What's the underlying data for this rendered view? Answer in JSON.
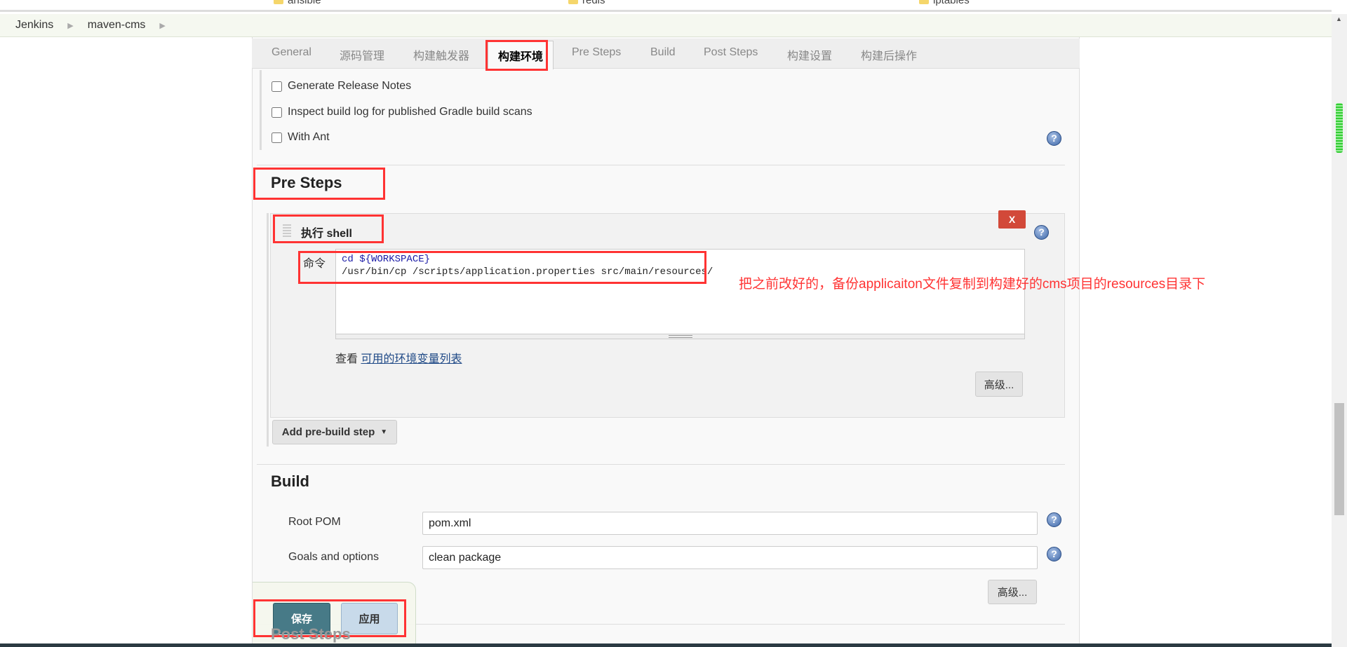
{
  "bookmarks": [
    {
      "label": "ansible",
      "icon": "folder-icon"
    },
    {
      "label": "redis",
      "icon": "folder-icon"
    },
    {
      "label": "iptables",
      "icon": "folder-icon"
    }
  ],
  "breadcrumb": [
    "Jenkins",
    "maven-cms"
  ],
  "tabs": [
    {
      "label": "General"
    },
    {
      "label": "源码管理"
    },
    {
      "label": "构建触发器"
    },
    {
      "label": "构建环境",
      "active": true
    },
    {
      "label": "Pre Steps"
    },
    {
      "label": "Build"
    },
    {
      "label": "Post Steps"
    },
    {
      "label": "构建设置"
    },
    {
      "label": "构建后操作"
    }
  ],
  "build_env": {
    "options": [
      {
        "label": "Generate Release Notes",
        "checked": false
      },
      {
        "label": "Inspect build log for published Gradle build scans",
        "checked": false
      },
      {
        "label": "With Ant",
        "checked": false
      }
    ]
  },
  "pre_steps": {
    "title": "Pre Steps",
    "shell": {
      "title": "执行 shell",
      "delete_label": "X",
      "command_label": "命令",
      "command_lines": [
        "cd ${WORKSPACE}",
        "/usr/bin/cp /scripts/application.properties src/main/resources/"
      ],
      "view_prefix": "查看",
      "env_link": "可用的环境变量列表",
      "advanced_label": "高级..."
    },
    "add_step_label": "Add pre-build step"
  },
  "annotation": "把之前改好的，备份applicaiton文件复制到构建好的cms项目的resources目录下",
  "build": {
    "title": "Build",
    "root_pom_label": "Root POM",
    "root_pom_value": "pom.xml",
    "goals_label": "Goals and options",
    "goals_value": "clean package",
    "advanced_label": "高级..."
  },
  "post_steps_title": "Post Steps",
  "footer": {
    "save_label": "保存",
    "apply_label": "应用"
  },
  "colors": {
    "accent_red": "#ff3333",
    "save_button": "#477a87",
    "apply_button": "#c8daea",
    "delete_button": "#d24939",
    "link": "#204a87"
  }
}
